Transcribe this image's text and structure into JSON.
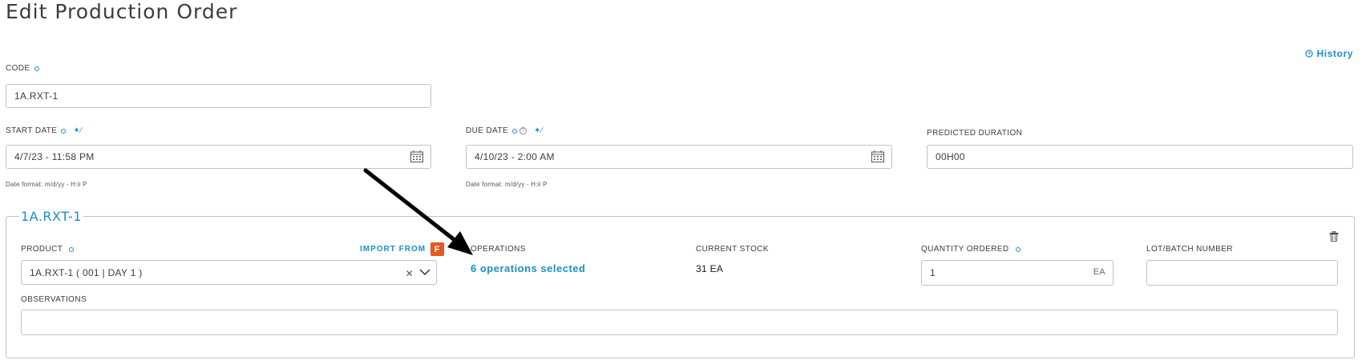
{
  "page": {
    "title": "Edit Production Order",
    "history_label": "History"
  },
  "code": {
    "label": "CODE",
    "value": "1A.RXT-1"
  },
  "start_date": {
    "label": "START DATE",
    "value": "4/7/23 - 11:58 PM",
    "hint": "Date format: m/d/yy - H:ii P"
  },
  "due_date": {
    "label": "DUE DATE",
    "value": "4/10/23 - 2:00 AM",
    "hint": "Date format: m/d/yy - H:ii P"
  },
  "predicted_duration": {
    "label": "PREDICTED DURATION",
    "value": "00H00"
  },
  "item": {
    "legend": "1A.RXT-1",
    "product": {
      "label": "PRODUCT",
      "value": "1A.RXT-1 ( 001 | DAY 1 )",
      "import_label": "IMPORT FROM",
      "import_badge": "F"
    },
    "operations": {
      "label": "OPERATIONS",
      "link": "6 operations selected"
    },
    "current_stock": {
      "label": "CURRENT STOCK",
      "value": "31 EA"
    },
    "quantity": {
      "label": "QUANTITY ORDERED",
      "value": "1",
      "unit": "EA"
    },
    "lot": {
      "label": "LOT/BATCH NUMBER",
      "value": ""
    },
    "observations": {
      "label": "OBSERVATIONS",
      "value": ""
    }
  },
  "colors": {
    "accent": "#1a8fc7",
    "border": "#c2c2c2",
    "text": "#3c3c3c",
    "import_badge": "#e8571f"
  },
  "icons": [
    "history-icon",
    "required-dot-icon",
    "magic-wand-icon",
    "help-icon",
    "calendar-icon",
    "trash-icon",
    "clear-icon",
    "chevron-down-icon",
    "import-badge-icon",
    "annotation-arrow"
  ]
}
